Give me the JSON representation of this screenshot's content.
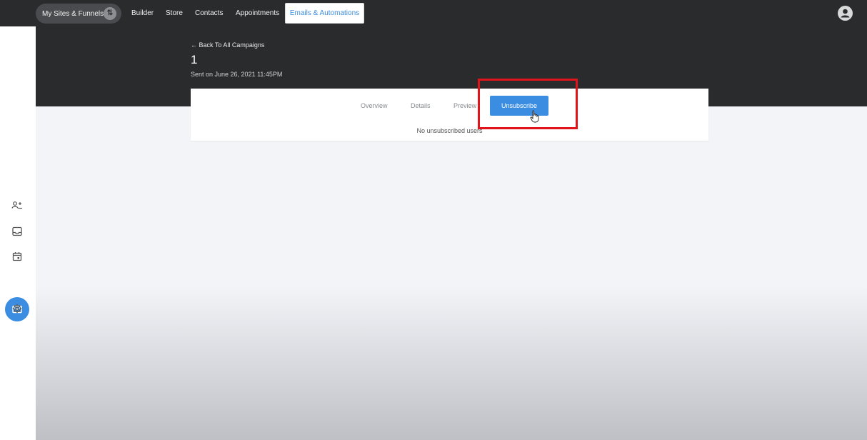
{
  "nav": {
    "sites_label": "My Sites & Funnels",
    "items": [
      "Builder",
      "Store",
      "Contacts",
      "Appointments"
    ],
    "active": "Emails & Automations"
  },
  "campaign": {
    "back_label": "← Back To All Campaigns",
    "title": "1",
    "sent_on": "Sent on June 26, 2021 11:45PM"
  },
  "tabs": {
    "items": [
      "Overview",
      "Details",
      "Preview"
    ],
    "active": "Unsubscribe"
  },
  "unsubscribe": {
    "empty_message": "No unsubscribed users"
  },
  "colors": {
    "accent": "#3a8de0",
    "highlight": "#e0141a",
    "nav_bg": "#2a2b2d"
  },
  "icons": [
    "swap-icon",
    "account-icon",
    "contacts-icon",
    "inbox-icon",
    "calendar-icon",
    "mail-icon",
    "settings-icon",
    "pointer-cursor-icon"
  ]
}
